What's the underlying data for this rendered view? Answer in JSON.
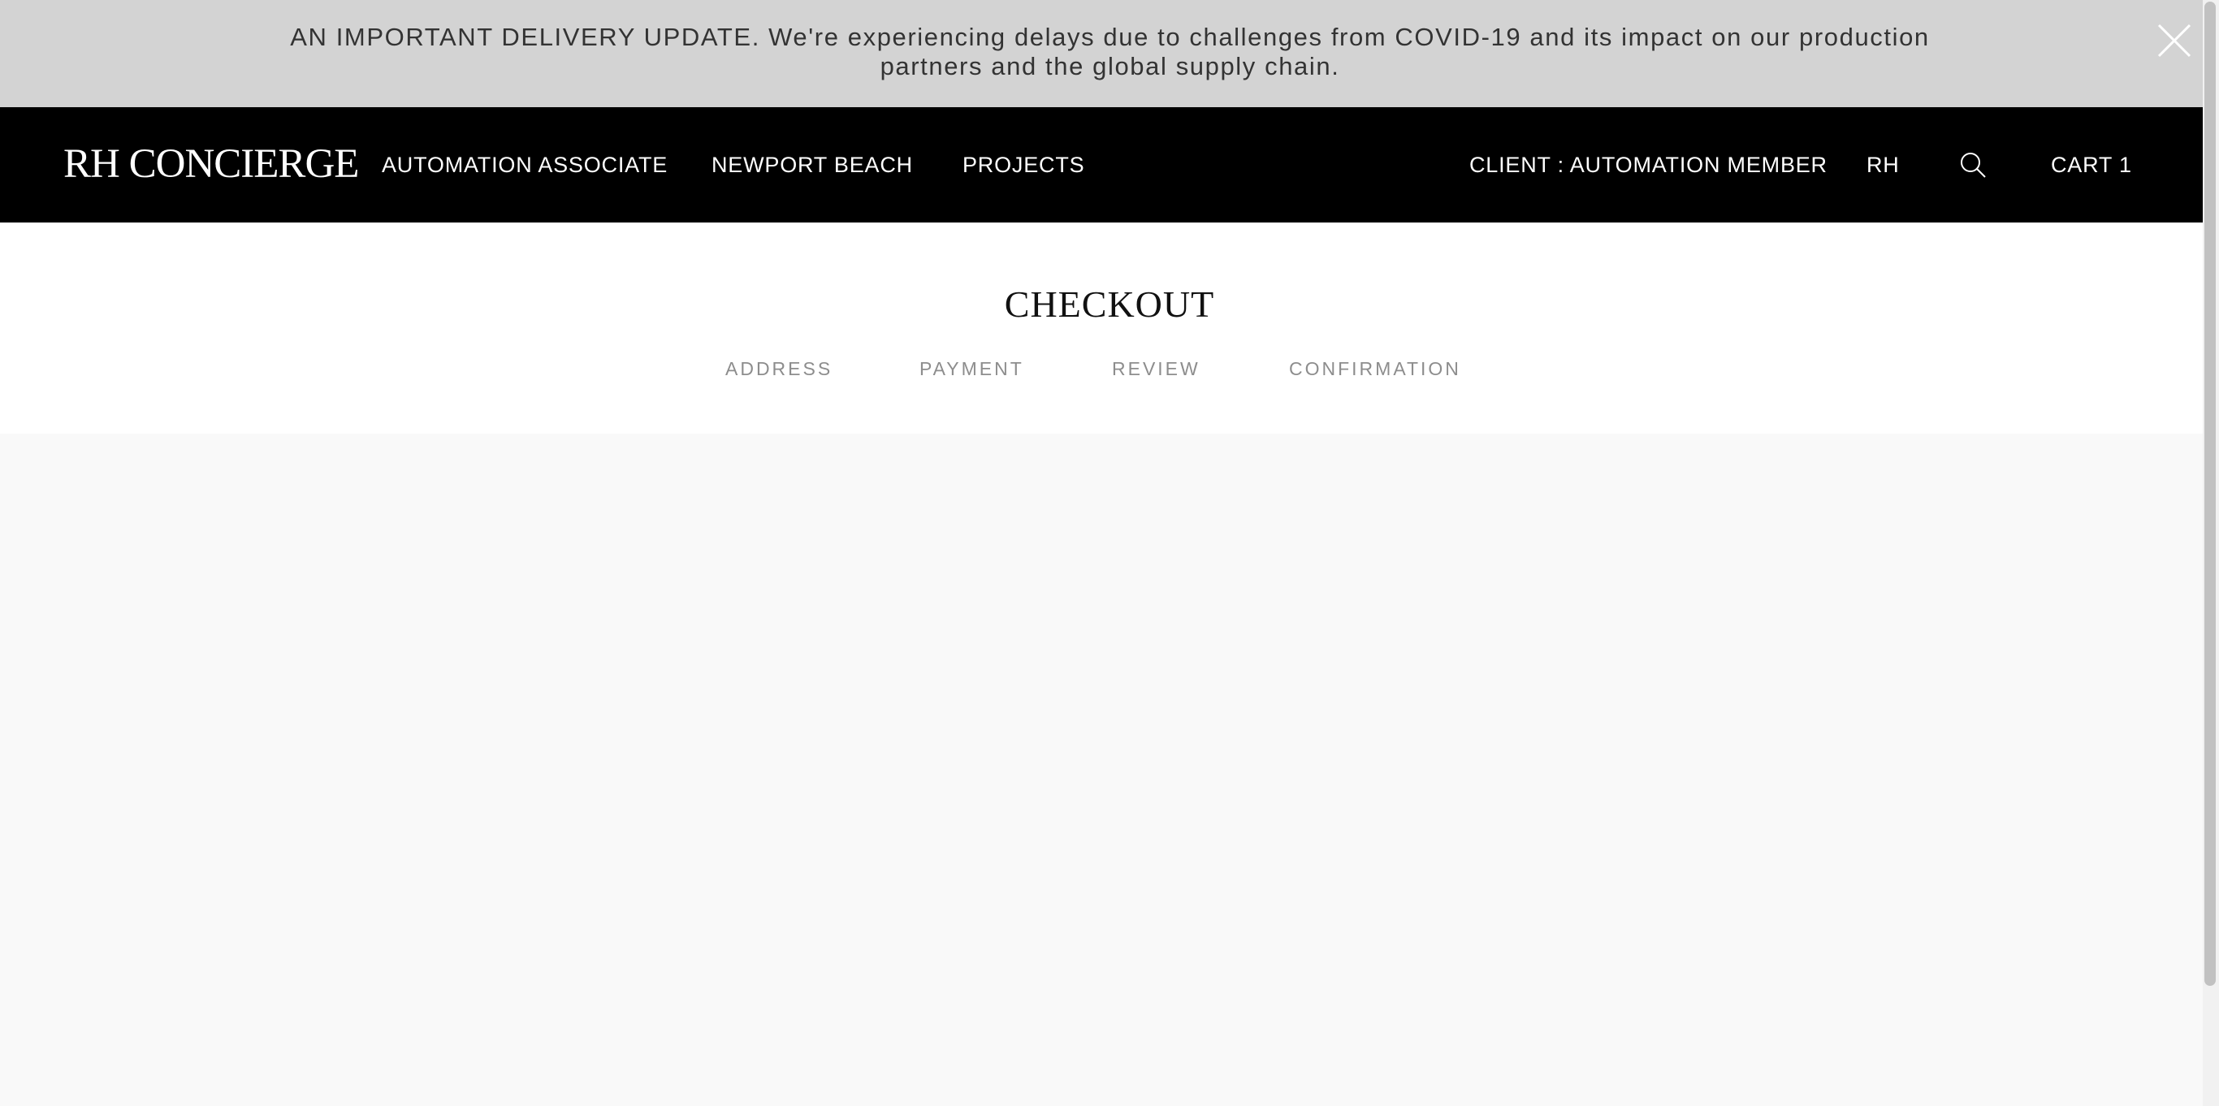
{
  "banner": {
    "message": "AN IMPORTANT DELIVERY UPDATE. We're experiencing delays due to challenges from COVID-19 and its impact on our production partners and the global supply chain.",
    "close_icon": "close-icon"
  },
  "header": {
    "logo": "RH CONCIERGE",
    "nav": {
      "associate": "AUTOMATION ASSOCIATE",
      "location": "NEWPORT BEACH",
      "projects": "PROJECTS"
    },
    "client": "CLIENT : AUTOMATION MEMBER",
    "brand": "RH",
    "search_icon": "search-icon",
    "cart": "CART 1"
  },
  "checkout": {
    "title": "CHECKOUT",
    "steps": {
      "address": "ADDRESS",
      "payment": "PAYMENT",
      "review": "REVIEW",
      "confirmation": "CONFIRMATION"
    }
  },
  "colors": {
    "banner_bg": "#d3d3d3",
    "header_bg": "#000000",
    "step_text": "#8d8d8d",
    "content_bg": "#f9f9f9"
  }
}
